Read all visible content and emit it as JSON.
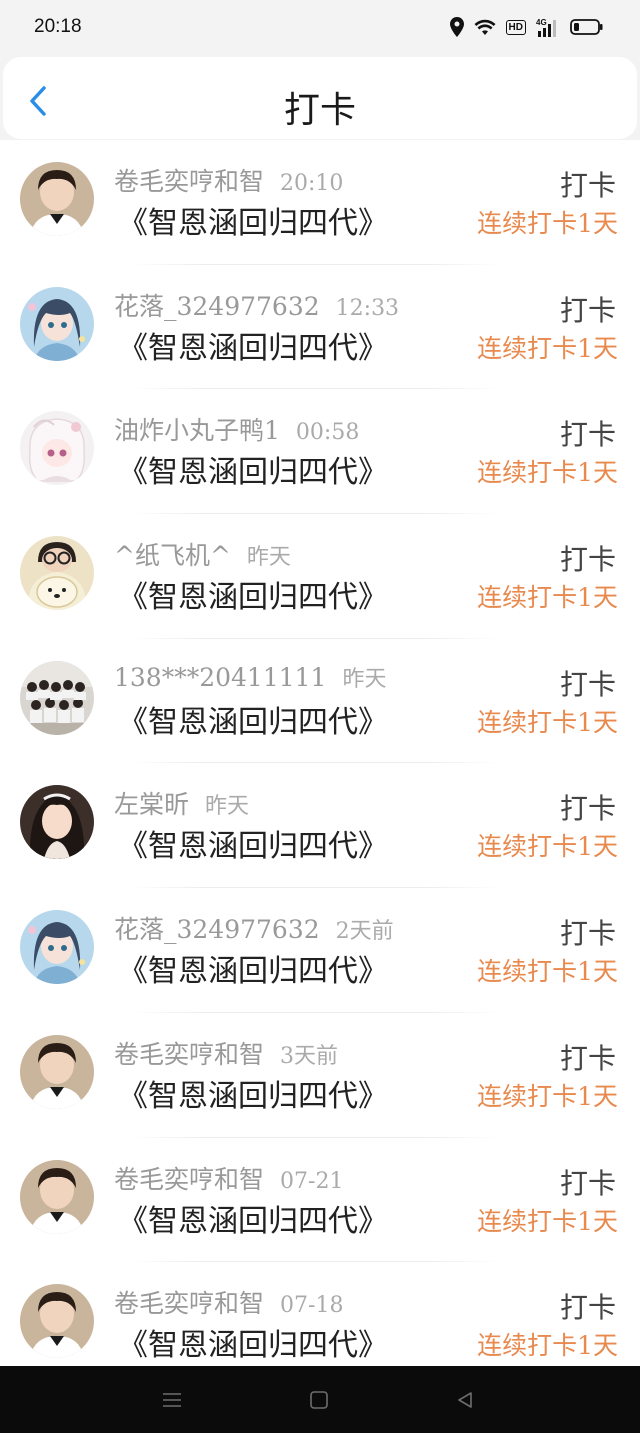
{
  "status_bar": {
    "time": "20:18",
    "network": "4G",
    "hd": "HD"
  },
  "header": {
    "title": "打卡"
  },
  "colors": {
    "streak": "#e8894e",
    "back_arrow": "#2a8ee6"
  },
  "items": [
    {
      "name": "卷毛奕哼和智",
      "time": "20:10",
      "book": "《智恩涵回归四代》",
      "action": "打卡",
      "streak": "连续打卡1天",
      "avatar": "boy"
    },
    {
      "name": "花落_324977632",
      "time": "12:33",
      "book": "《智恩涵回归四代》",
      "action": "打卡",
      "streak": "连续打卡1天",
      "avatar": "anime-girl"
    },
    {
      "name": "油炸小丸子鸭1",
      "time": "00:58",
      "book": "《智恩涵回归四代》",
      "action": "打卡",
      "streak": "连续打卡1天",
      "avatar": "anime-white"
    },
    {
      "name": "^纸飞机^",
      "time": "昨天",
      "book": "《智恩涵回归四代》",
      "action": "打卡",
      "streak": "连续打卡1天",
      "avatar": "glasses"
    },
    {
      "name": "138***20411111",
      "time": "昨天",
      "book": "《智恩涵回归四代》",
      "action": "打卡",
      "streak": "连续打卡1天",
      "avatar": "group"
    },
    {
      "name": "左棠昕",
      "time": "昨天",
      "book": "《智恩涵回归四代》",
      "action": "打卡",
      "streak": "连续打卡1天",
      "avatar": "girl"
    },
    {
      "name": "花落_324977632",
      "time": "2天前",
      "book": "《智恩涵回归四代》",
      "action": "打卡",
      "streak": "连续打卡1天",
      "avatar": "anime-girl"
    },
    {
      "name": "卷毛奕哼和智",
      "time": "3天前",
      "book": "《智恩涵回归四代》",
      "action": "打卡",
      "streak": "连续打卡1天",
      "avatar": "boy"
    },
    {
      "name": "卷毛奕哼和智",
      "time": "07-21",
      "book": "《智恩涵回归四代》",
      "action": "打卡",
      "streak": "连续打卡1天",
      "avatar": "boy"
    },
    {
      "name": "卷毛奕哼和智",
      "time": "07-18",
      "book": "《智恩涵回归四代》",
      "action": "打卡",
      "streak": "连续打卡1天",
      "avatar": "boy"
    }
  ]
}
